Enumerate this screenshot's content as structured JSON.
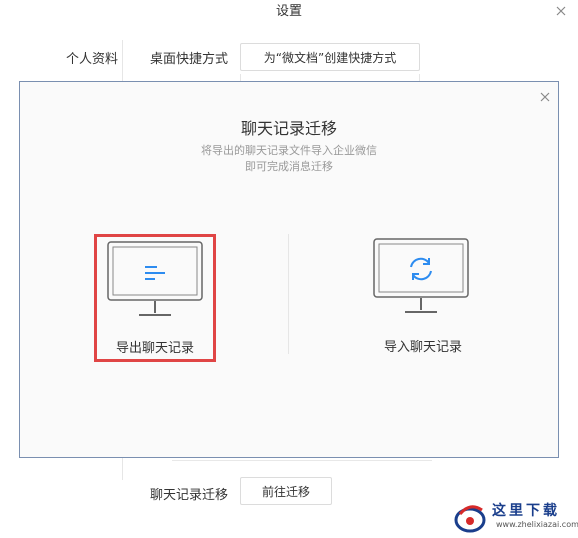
{
  "window": {
    "title": "设置"
  },
  "nav": {
    "profile": "个人资料"
  },
  "rows": {
    "desktop_label": "桌面快捷方式",
    "desktop_button": "为“微文档”创建快捷方式",
    "migrate_label": "聊天记录迁移",
    "migrate_button": "前往迁移"
  },
  "modal": {
    "title": "聊天记录迁移",
    "desc_line1": "将导出的聊天记录文件导入企业微信",
    "desc_line2": "即可完成消息迁移",
    "export_label": "导出聊天记录",
    "import_label": "导入聊天记录"
  },
  "watermark": {
    "title": "这里下载",
    "url": "www.zhelixiazai.com"
  },
  "colors": {
    "accent_blue": "#2d8cf0",
    "highlight_red": "#e04545",
    "monitor_gray": "#666666",
    "modal_border": "#7a8fb0"
  },
  "icons": {
    "export": "monitor-lines-icon",
    "import": "monitor-sync-icon",
    "close": "close-icon"
  }
}
